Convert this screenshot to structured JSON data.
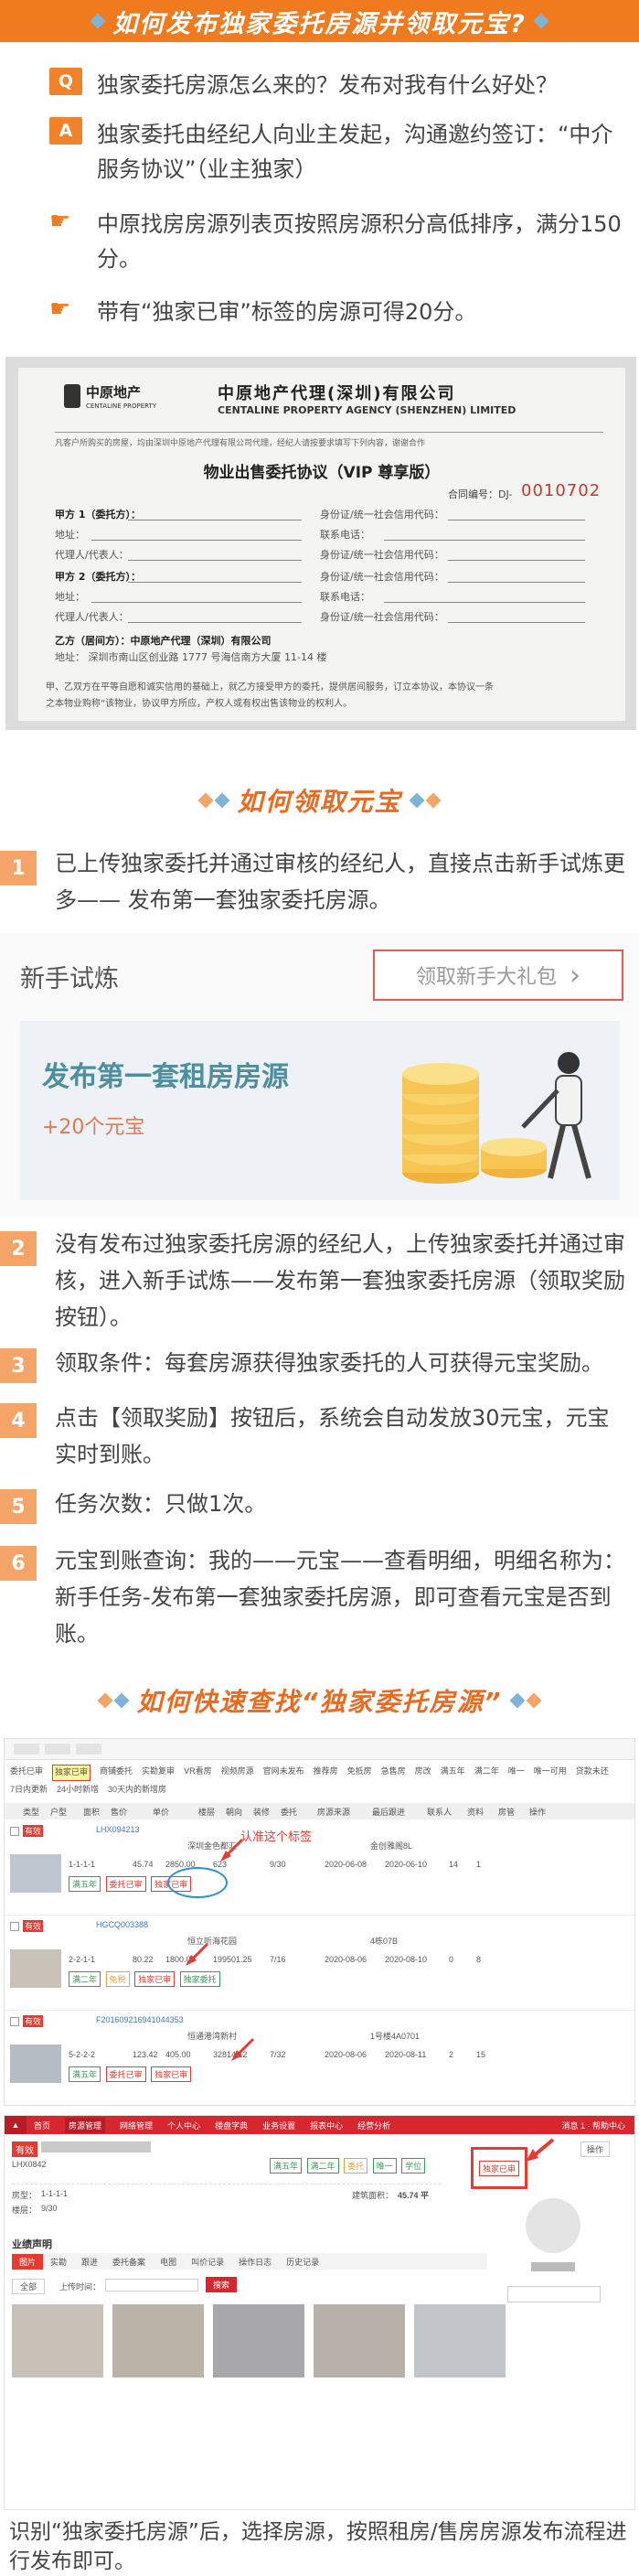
{
  "header": {
    "title": "如何发布独家委托房源并领取元宝?"
  },
  "qa": [
    {
      "badge": "Q",
      "text": "独家委托房源怎么来的？发布对我有什么好处？"
    },
    {
      "badge": "A",
      "text": "独家委托由经纪人向业主发起，沟通邀约签订：“中介服务协议”（业主独家）"
    }
  ],
  "points": [
    {
      "text": "中原找房房源列表页按照房源积分高低排序，满分150分。"
    },
    {
      "text": "带有“独家已审”标签的房源可得20分。"
    }
  ],
  "document": {
    "company_cn": "中原地产代理(深圳)有限公司",
    "company_en": "CENTALINE PROPERTY AGENCY (SHENZHEN) LIMITED",
    "logo_cn": "中原地产",
    "logo_en": "CENTALINE PROPERTY",
    "intro": "凡客户所购买的房屋，均由深圳中原地产代理有限公司代理，经纪人请按要求填写下列内容，谢谢合作",
    "title": "物业出售委托协议（VIP 尊享版）",
    "contract_label": "合同编号：DJ-",
    "contract_no": "0010702",
    "party_a1": "甲方 1（委托方）：",
    "party_a2": "甲方 2（委托方）：",
    "address": "地址：",
    "agent": "代理人/代表人：",
    "id_label": "身份证/统一社会信用代码：",
    "phone_label": "联系电话：",
    "party_b": "乙方（居间方）：中原地产代理（深圳）有限公司",
    "party_b_addr": "地址：    深圳市南山区创业路 1777 号海信南方大厦 11-14 楼",
    "footer1": "甲、乙双方在平等自愿和诚实信用的基础上，就乙方接受甲方的委托，提供居间服务，订立本协议，本协议一条",
    "footer2": "之本物业购称“该物业，协议甲方所应，产权人或有权出售该物业的权利人。"
  },
  "section2": {
    "title": "如何领取元宝"
  },
  "step1": {
    "num": "1",
    "text": "已上传独家委托并通过审核的经纪人，直接点击新手试炼更多—— 发布第一套独家委托房源。"
  },
  "novice": {
    "title": "新手试炼",
    "button": "领取新手大礼包",
    "chevron": "›",
    "card_title": "发布第一套租房房源",
    "reward": "+20个元宝"
  },
  "steps": [
    {
      "num": "2",
      "text": "没有发布过独家委托房源的经纪人，上传独家委托并通过审核，进入新手试炼——发布第一套独家委托房源（领取奖励按钮）。"
    },
    {
      "num": "3",
      "text": "领取条件：每套房源获得独家委托的人可获得元宝奖励。"
    },
    {
      "num": "4",
      "text": "点击【领取奖励】按钮后，系统会自动发放30元宝，元宝实时到账。"
    },
    {
      "num": "5",
      "text": "任务次数：只做1次。"
    },
    {
      "num": "6",
      "text": "元宝到账查询：我的——元宝——查看明细，明细名称为：新手任务-发布第一套独家委托房源，即可查看元宝是否到账。"
    }
  ],
  "section3": {
    "title": "如何快速查找“独家委托房源”"
  },
  "crm_list": {
    "filter_tabs": [
      "委托已审",
      "独家已审",
      "商铺委托",
      "实勘复审",
      "VR看房",
      "视频房源",
      "官网未发布",
      "推荐房",
      "免抵房",
      "急售房",
      "房改",
      "满五年",
      "满二年",
      "唯一",
      "唯一可用"
    ],
    "filter_tabs2": [
      "贷款未还",
      "7日内更新",
      "24小时新增",
      "30天内的新增房"
    ],
    "columns": [
      "",
      "类型",
      "户型",
      "面积",
      "售价",
      "单价",
      "楼层",
      "朝向",
      "装修",
      "委托",
      "房源来源",
      "最后跟进",
      "联系人",
      "资料",
      "房管",
      "操作"
    ],
    "annotation": "认准这个标签",
    "rows": [
      {
        "status": "有效",
        "code": "LHX094213",
        "estate": "深圳金色都汇",
        "building": "金创雅阁8L",
        "room": "1-1-1-1",
        "area": "45.74",
        "price": "2850.00",
        "unit": "623",
        "floor": "9/30",
        "date1": "2020-06-08",
        "date2": "2020-06-10",
        "n1": "14",
        "n2": "1",
        "tag": "满五年",
        "tags": [
          "委托已审",
          "独家已审"
        ]
      },
      {
        "status": "有效",
        "code": "HGCQ003388",
        "estate": "恒立听海花园",
        "building": "4栋07B",
        "room": "2-2-1-1",
        "area": "80.22",
        "price": "1800.00",
        "unit": "199501.25",
        "floor": "7/16",
        "date1": "2020-08-06",
        "date2": "2020-08-10",
        "n1": "0",
        "n2": "8",
        "tag": "满二年",
        "tags": [
          "免税",
          "独家已审",
          "独家委托"
        ]
      },
      {
        "status": "有效",
        "code": "F201609216941044353",
        "estate": "恒通港湾新村",
        "building": "1号楼4A0701",
        "room": "5-2-2-2",
        "area": "123.42",
        "price": "405.00",
        "unit": "32814.12",
        "floor": "7/32",
        "date1": "2020-08-06",
        "date2": "2020-08-11",
        "n1": "2",
        "n2": "15",
        "tag": "满五年",
        "tags": [
          "委托已审",
          "独家已审"
        ]
      }
    ]
  },
  "crm_detail": {
    "nav": [
      "首页",
      "房源管理",
      "网络管理",
      "个人中心",
      "楼盘字典",
      "业务设置",
      "报表中心",
      "经营分析"
    ],
    "right_info": "消息 1 · 帮助中心",
    "status": "有效",
    "code": "LHX0842",
    "tags": [
      "满五年",
      "满二年",
      "委托",
      "唯一",
      "学位",
      "独家已审"
    ],
    "op": "操作",
    "room_label": "房型：",
    "room": "1-1-1-1",
    "area_label": "建筑面积：",
    "area": "45.74 平",
    "floor_label": "楼层：",
    "floor": "9/30",
    "section_title": "业绩声明",
    "tabs": [
      "图片",
      "实勘",
      "跟进",
      "委托备案",
      "电图",
      "叫价记录",
      "操作日志",
      "历史记录"
    ],
    "select": "全部",
    "upload": "上传时间：",
    "search_btn": "搜索"
  },
  "footer": {
    "text": "识别“独家委托房源”后，选择房源，按照租房/售房房源发布流程进行发布即可。"
  },
  "colors": {
    "orange": "#f07a1e",
    "soft_orange": "#f4a466",
    "red": "#e63b32",
    "teal": "#4d8fa0",
    "nav_red": "#d8262f"
  }
}
